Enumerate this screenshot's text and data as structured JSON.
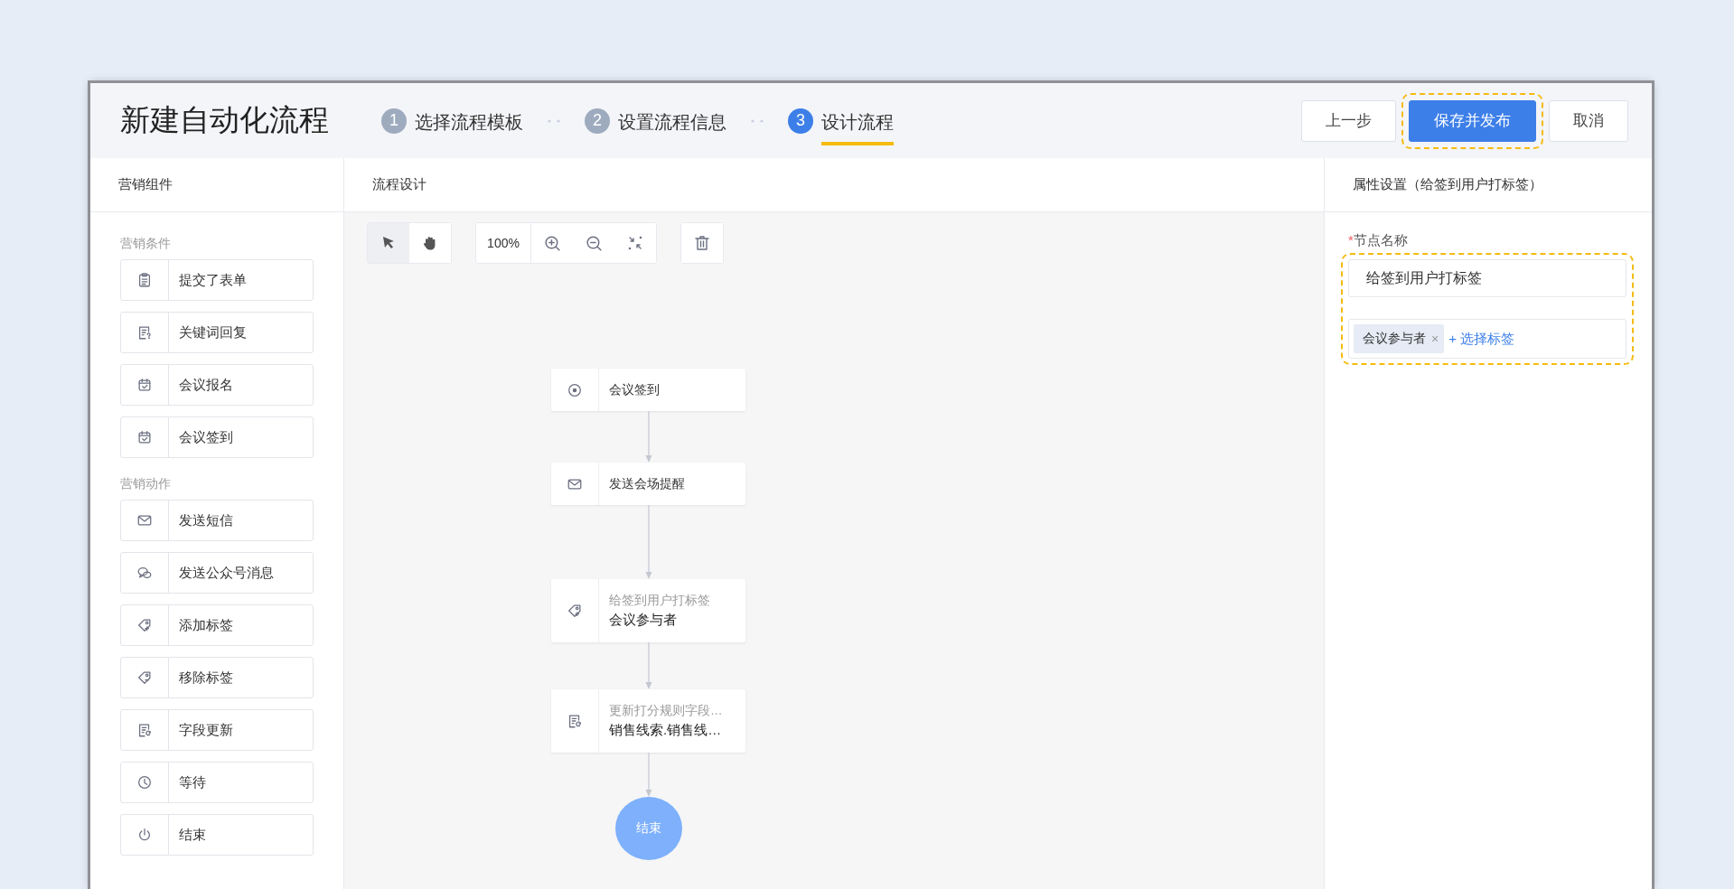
{
  "header": {
    "title": "新建自动化流程",
    "steps": [
      {
        "number": "1",
        "label": "选择流程模板",
        "selected": false
      },
      {
        "number": "2",
        "label": "设置流程信息",
        "selected": false
      },
      {
        "number": "3",
        "label": "设计流程",
        "selected": true
      }
    ],
    "buttons": [
      {
        "label": "上一步",
        "kind": "default",
        "highlighted": false
      },
      {
        "label": "保存并发布",
        "kind": "primary",
        "highlighted": true
      },
      {
        "label": "取消",
        "kind": "default",
        "highlighted": false
      }
    ]
  },
  "components_panel": {
    "title": "营销组件",
    "groups": [
      {
        "title": "营销条件",
        "items": [
          {
            "label": "提交了表单",
            "kind": "clipboard"
          },
          {
            "label": "关键词回复",
            "kind": "doc-question"
          },
          {
            "label": "会议报名",
            "kind": "calendar"
          },
          {
            "label": "会议签到",
            "kind": "calendar"
          }
        ]
      },
      {
        "title": "营销动作",
        "items": [
          {
            "label": "发送短信",
            "kind": "mail"
          },
          {
            "label": "发送公众号消息",
            "kind": "chat"
          },
          {
            "label": "添加标签",
            "kind": "tag-add"
          },
          {
            "label": "移除标签",
            "kind": "tag-remove"
          },
          {
            "label": "字段更新",
            "kind": "doc-refresh"
          },
          {
            "label": "等待",
            "kind": "clock"
          },
          {
            "label": "结束",
            "kind": "power"
          }
        ]
      }
    ]
  },
  "canvas": {
    "title": "流程设计",
    "tools": [
      {
        "kind": "pointer",
        "selected": true
      },
      {
        "kind": "hand",
        "selected": false
      }
    ],
    "zoom": "100%",
    "nodes": [
      {
        "kind": "target",
        "label": "会议签到"
      },
      {
        "kind": "mail",
        "label": "发送会场提醒"
      },
      {
        "kind": "tag-add",
        "caption": "给签到用户打标签",
        "label": "会议参与者"
      },
      {
        "kind": "doc-refresh",
        "caption": "更新打分规则字段…",
        "label": "销售线索.销售线…"
      }
    ],
    "end": "结束"
  },
  "properties_panel": {
    "title": "属性设置（给签到用户打标签）",
    "required_mark": "*",
    "field_label": "节点名称",
    "highlighted": true,
    "name_value": "给签到用户打标签",
    "tags": [
      {
        "label": "会议参与者",
        "remove": "×"
      }
    ],
    "add_tag": "+ 选择标签"
  }
}
